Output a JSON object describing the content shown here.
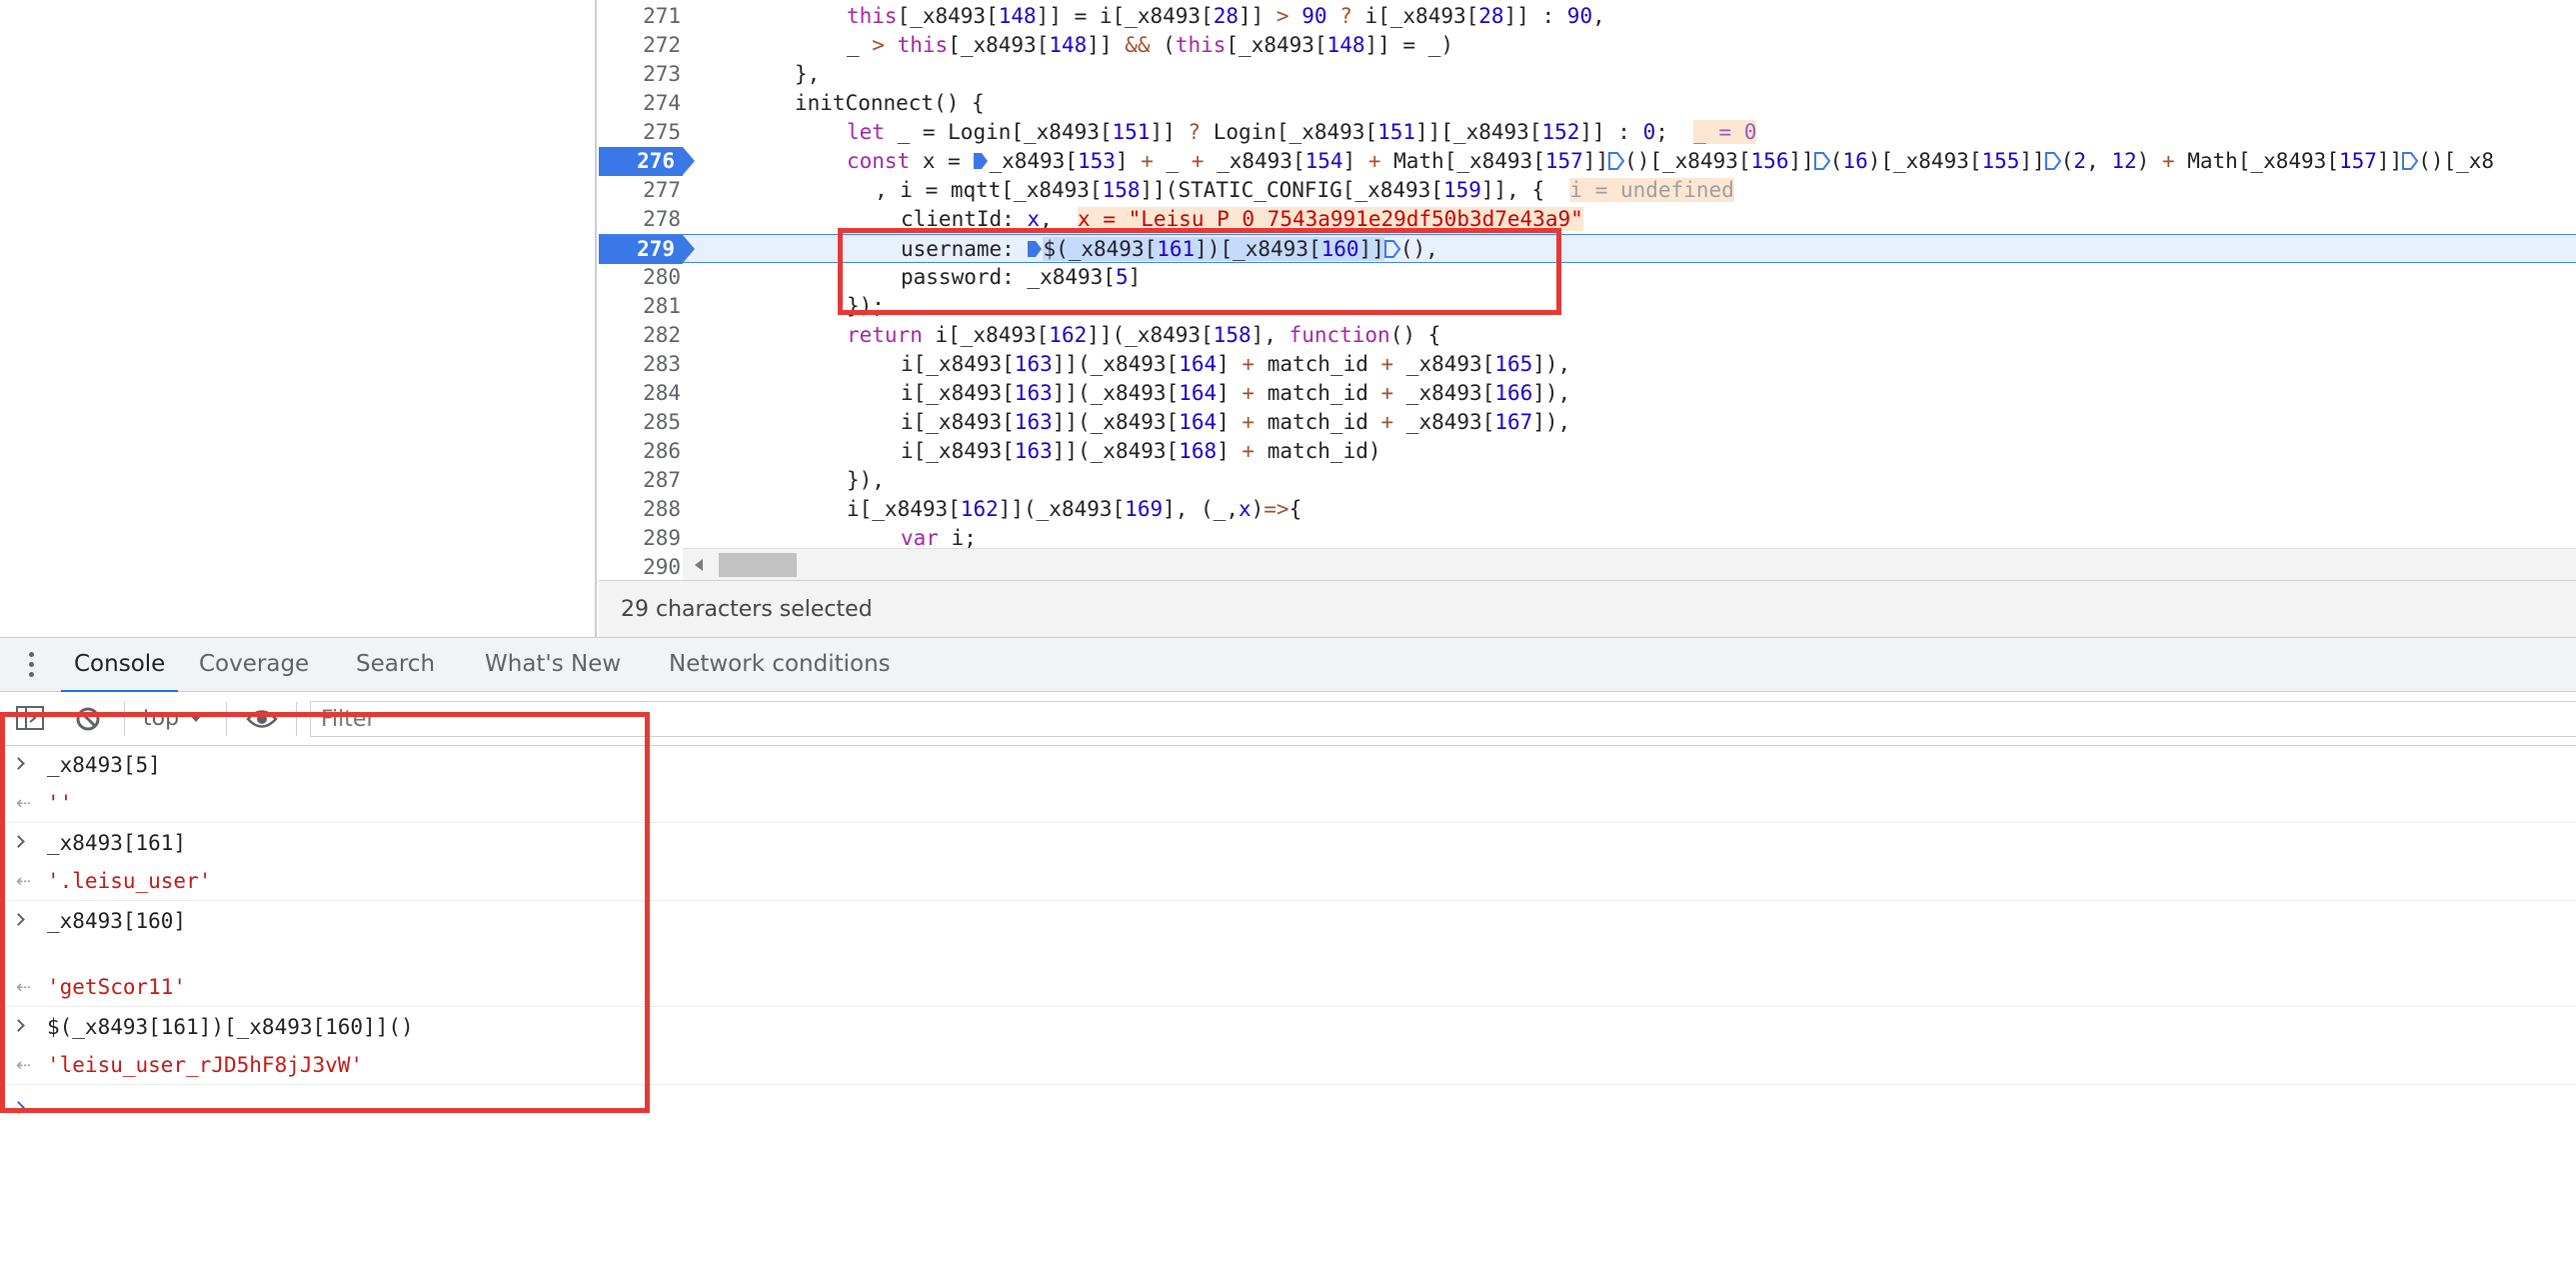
{
  "editor": {
    "lines": [
      {
        "num": "271",
        "code": "this[_x8493[148]] = i[_x8493[28]] > 90 ? i[_x8493[28]] : 90,"
      },
      {
        "num": "272",
        "code": "_ > this[_x8493[148]] && (this[_x8493[148]] = _)"
      },
      {
        "num": "273",
        "code": "},"
      },
      {
        "num": "274",
        "code": "initConnect() {"
      },
      {
        "num": "275",
        "code": "let _ = Login[_x8493[151]] ? Login[_x8493[151]][_x8493[152]] : 0;",
        "hint": "_ = 0"
      },
      {
        "num": "276",
        "code": "const x = _x8493[153] + _ + _x8493[154] + Math[_x8493[157]]()[_x8493[156]](16)[_x8493[155]](2, 12) + Math[_x8493[157]]()[_x8",
        "breakpoint": true
      },
      {
        "num": "277",
        "code": ", i = mqtt[_x8493[158]](STATIC_CONFIG[_x8493[159]], {",
        "hint": "i = undefined"
      },
      {
        "num": "278",
        "code": "clientId: x,",
        "hint": "x = \"Leisu_P_0_7543a991e29df50b3d7e43a9\""
      },
      {
        "num": "279",
        "code": "username: $(_x8493[161])[_x8493[160]](),",
        "breakpoint": true,
        "current": true
      },
      {
        "num": "280",
        "code": "password: _x8493[5]"
      },
      {
        "num": "281",
        "code": "});"
      },
      {
        "num": "282",
        "code": "return i[_x8493[162]](_x8493[158], function() {"
      },
      {
        "num": "283",
        "code": "i[_x8493[163]](_x8493[164] + match_id + _x8493[165]),"
      },
      {
        "num": "284",
        "code": "i[_x8493[163]](_x8493[164] + match_id + _x8493[166]),"
      },
      {
        "num": "285",
        "code": "i[_x8493[163]](_x8493[164] + match_id + _x8493[167]),"
      },
      {
        "num": "286",
        "code": "i[_x8493[163]](_x8493[168] + match_id)"
      },
      {
        "num": "287",
        "code": "}),"
      },
      {
        "num": "288",
        "code": "i[_x8493[162]](_x8493[169], (_,x)=>{"
      },
      {
        "num": "289",
        "code": "var i;"
      },
      {
        "num": "290",
        "code": ""
      }
    ],
    "status": "29 characters selected"
  },
  "drawer": {
    "tabs": [
      "Console",
      "Coverage",
      "Search",
      "What's New",
      "Network conditions"
    ],
    "active_tab": "Console",
    "context": "top",
    "filter_placeholder": "Filter"
  },
  "console": {
    "entries": [
      {
        "input": "_x8493[5]",
        "output": "''"
      },
      {
        "input": "_x8493[161]",
        "output": "'.leisu_user'"
      },
      {
        "input": "_x8493[160]",
        "output": "'getScor11'"
      },
      {
        "input": "$(_x8493[161])[_x8493[160]]()",
        "output": "'leisu_user_rJD5hF8jJ3vW'"
      }
    ]
  },
  "colors": {
    "breakpoint": "#3b78e7",
    "tab_accent": "#1a73e8",
    "annotation": "#e53935",
    "string": "#c41a16",
    "number": "#1c00cf",
    "keyword": "#a626a4"
  },
  "icons": [
    "kebab-menu-icon",
    "sidebar-toggle-icon",
    "clear-console-icon",
    "eye-icon",
    "dropdown-caret-icon",
    "step-marker-icon",
    "scroll-left-arrow-icon"
  ]
}
